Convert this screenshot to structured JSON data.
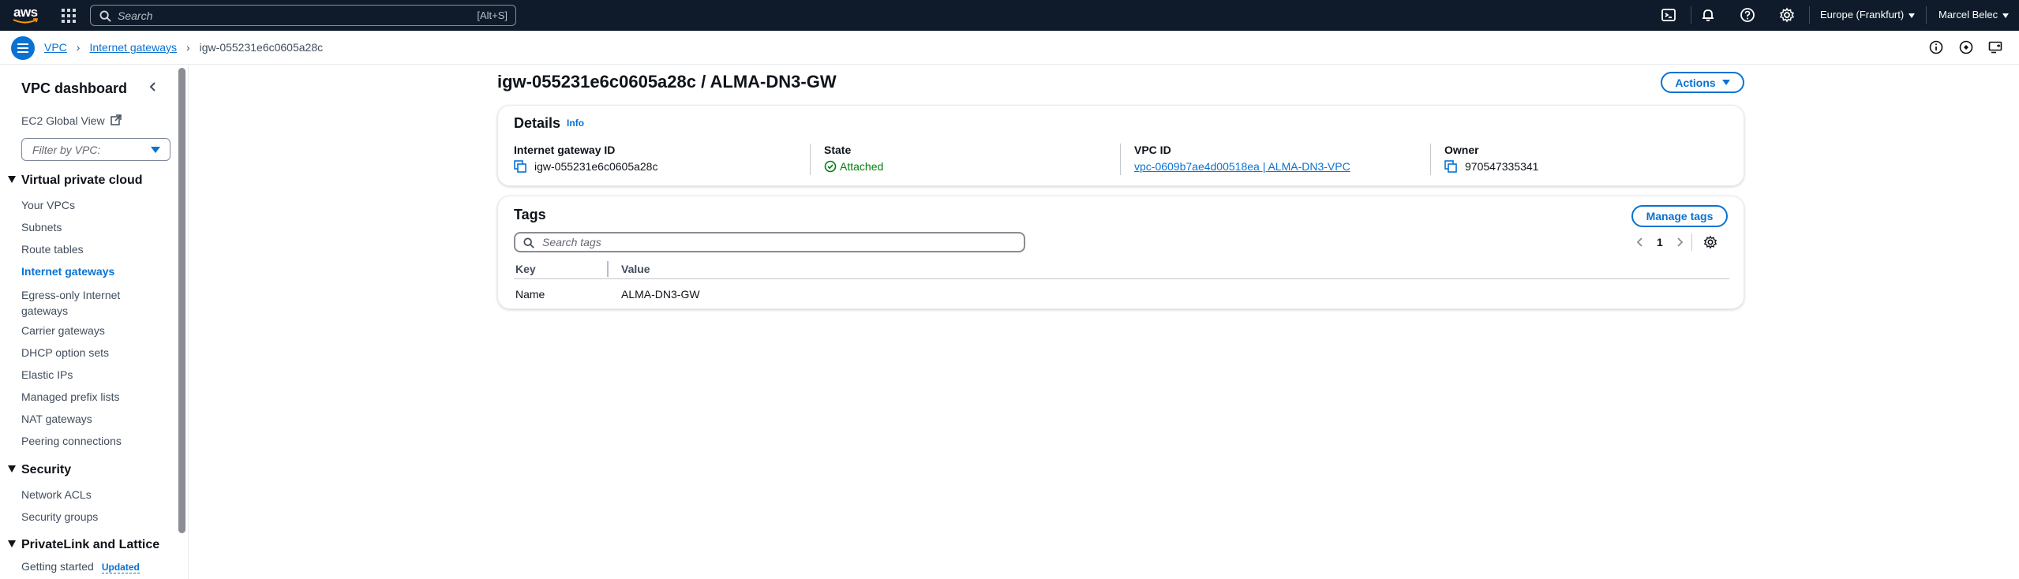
{
  "topnav": {
    "logo_text": "aws",
    "search_placeholder": "Search",
    "search_shortcut": "[Alt+S]",
    "region": "Europe (Frankfurt)",
    "user": "Marcel Belec"
  },
  "breadcrumb": {
    "items": [
      "VPC",
      "Internet gateways"
    ],
    "current": "igw-055231e6c0605a28c"
  },
  "sidebar": {
    "title": "VPC dashboard",
    "ec2_global_view": "EC2 Global View",
    "filter_placeholder": "Filter by VPC:",
    "sections": [
      {
        "title": "Virtual private cloud",
        "items": [
          "Your VPCs",
          "Subnets",
          "Route tables",
          "Internet gateways",
          "Egress-only Internet gateways",
          "Carrier gateways",
          "DHCP option sets",
          "Elastic IPs",
          "Managed prefix lists",
          "NAT gateways",
          "Peering connections"
        ]
      },
      {
        "title": "Security",
        "items": [
          "Network ACLs",
          "Security groups"
        ]
      },
      {
        "title": "PrivateLink and Lattice",
        "items": [
          "Getting started"
        ]
      }
    ],
    "active_item": "Internet gateways",
    "updated_badge": "Updated"
  },
  "main": {
    "title": "igw-055231e6c0605a28c / ALMA-DN3-GW",
    "actions_label": "Actions",
    "details": {
      "heading": "Details",
      "info_label": "Info",
      "fields": [
        {
          "label": "Internet gateway ID",
          "value": "igw-055231e6c0605a28c"
        },
        {
          "label": "State",
          "value": "Attached"
        },
        {
          "label": "VPC ID",
          "value": "vpc-0609b7ae4d00518ea | ALMA-DN3-VPC"
        },
        {
          "label": "Owner",
          "value": "970547335341"
        }
      ]
    },
    "tags": {
      "heading": "Tags",
      "manage_label": "Manage tags",
      "search_placeholder": "Search tags",
      "page": "1",
      "columns": [
        "Key",
        "Value"
      ],
      "rows": [
        {
          "key": "Name",
          "value": "ALMA-DN3-GW"
        }
      ]
    }
  },
  "colors": {
    "nav_bg": "#0f1b2a",
    "link": "#0972d3",
    "success": "#037f0c"
  }
}
